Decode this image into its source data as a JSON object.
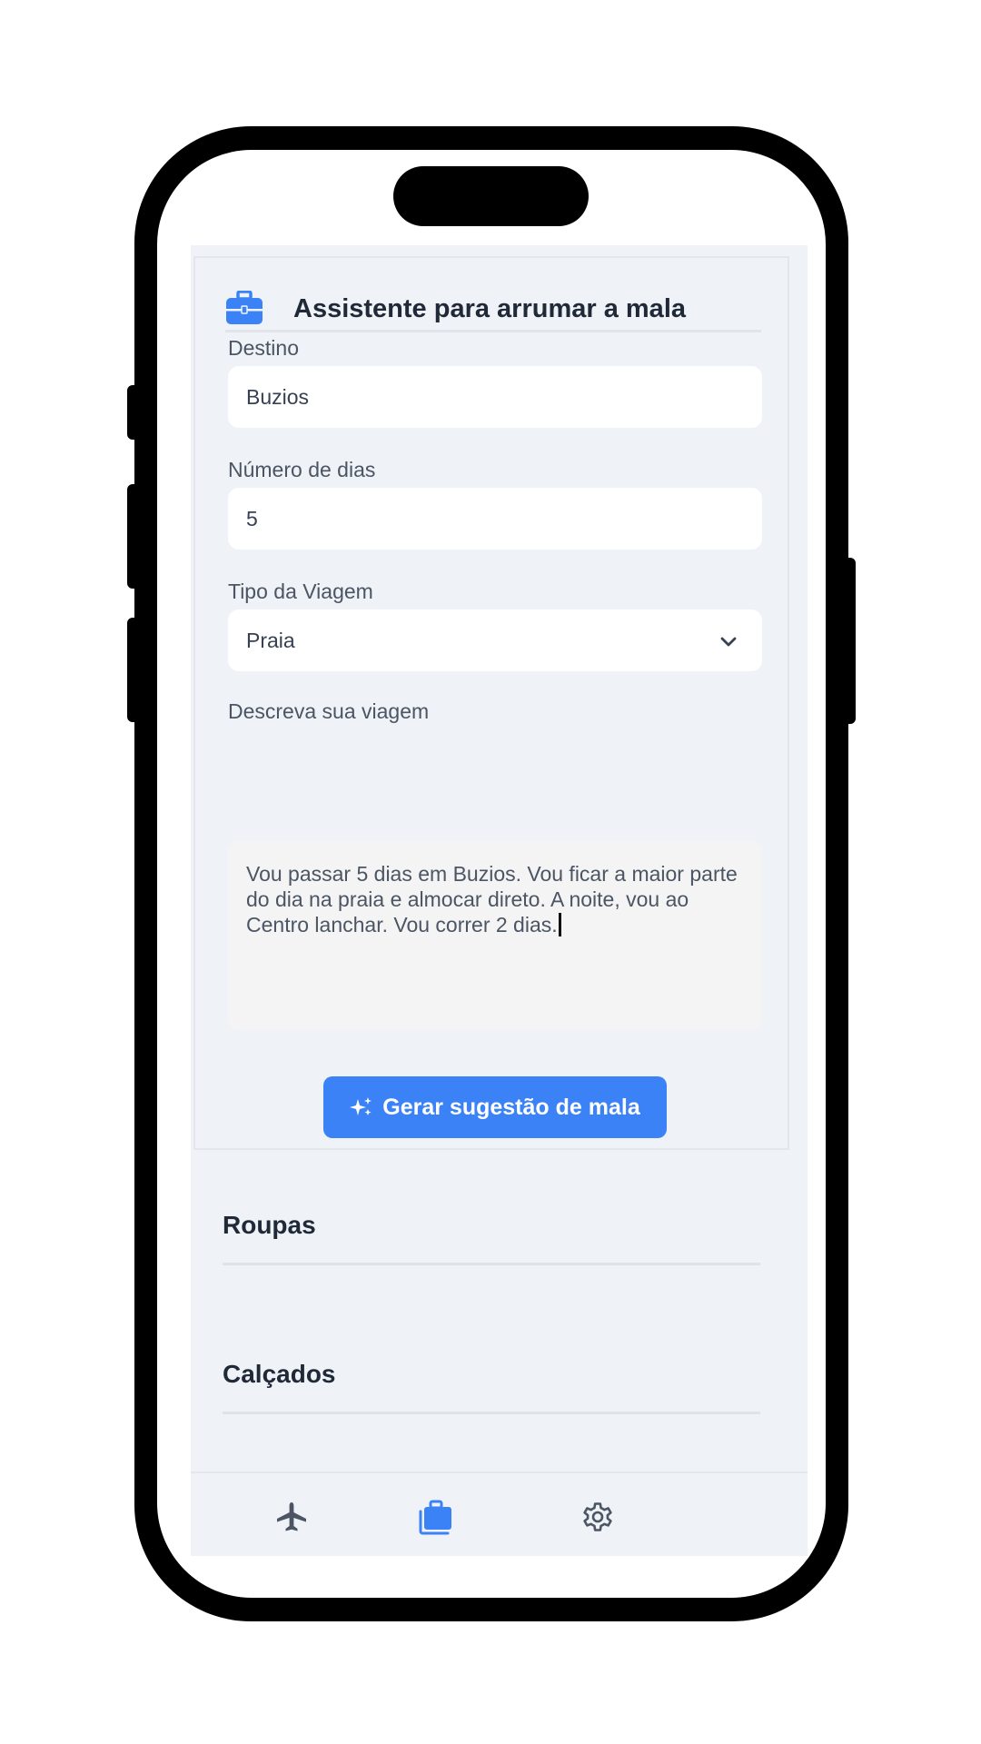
{
  "card": {
    "title": "Assistente para arrumar a mala",
    "icon": "briefcase-icon"
  },
  "form": {
    "destino_label": "Destino",
    "destino_value": "Buzios",
    "dias_label": "Número de dias",
    "dias_value": "5",
    "tipo_label": "Tipo da Viagem",
    "tipo_value": "Praia",
    "descricao_label": "Descreva sua viagem",
    "descricao_value": "Vou passar 5 dias em Buzios. Vou ficar a maior parte do dia na praia e almocar direto. A noite, vou ao Centro lanchar. Vou correr 2 dias."
  },
  "generate_button": {
    "label": "Gerar sugestão de mala",
    "icon": "sparkles-icon"
  },
  "sections": [
    {
      "title": "Roupas"
    },
    {
      "title": "Calçados"
    }
  ],
  "nav": {
    "items": [
      {
        "icon": "airplane-icon",
        "active": false
      },
      {
        "icon": "luggage-icon",
        "active": true
      },
      {
        "icon": "gear-icon",
        "active": false
      }
    ]
  },
  "colors": {
    "accent": "#3b82f6",
    "background": "#eff2f7",
    "inactive_icon": "#4b5563"
  }
}
